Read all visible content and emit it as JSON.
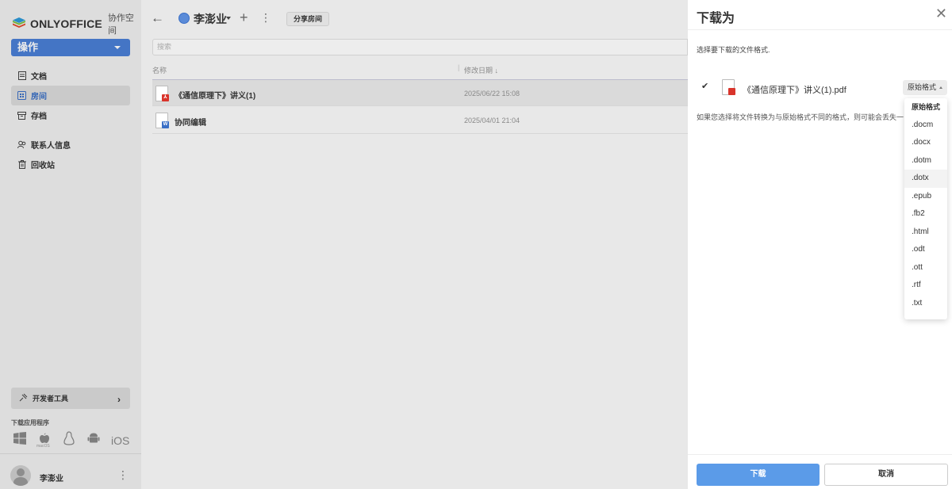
{
  "app": {
    "logo_text": "ONLYOFFICE",
    "logo_sub": "协作空间"
  },
  "sidebar": {
    "action_label": "操作",
    "items": [
      {
        "label": "文档",
        "icon": "document-icon"
      },
      {
        "label": "房间",
        "icon": "rooms-icon"
      },
      {
        "label": "存档",
        "icon": "archive-icon"
      },
      {
        "label": "联系人信息",
        "icon": "contacts-icon"
      },
      {
        "label": "回收站",
        "icon": "trash-icon"
      }
    ],
    "dev_tools_label": "开发者工具",
    "download_apps_label": "下载应用程序",
    "os_icons": [
      "windows-icon",
      "macos-icon",
      "linux-icon",
      "android-icon",
      "ios-icon"
    ],
    "ios_label": "iOS",
    "macos_label": "macOS",
    "user_name": "李澎业"
  },
  "main": {
    "room_title": "李澎业",
    "share_button": "分享房间",
    "search_placeholder": "搜索",
    "columns": {
      "name": "名称",
      "date": "修改日期"
    },
    "rows": [
      {
        "name": "《通信原理下》讲义(1)",
        "date": "2025/06/22 15:08",
        "type": "pdf"
      },
      {
        "name": "协同编辑",
        "date": "2025/04/01 21:04",
        "type": "docx"
      }
    ]
  },
  "panel": {
    "title": "下载为",
    "hint": "选择要下载的文件格式.",
    "file_name": "《通信原理下》讲义(1).pdf",
    "selected_format": "原始格式",
    "warning": "如果您选择将文件转换为与原始格式不同的格式，则可能会丢失一",
    "format_options": [
      "原始格式",
      ".docm",
      ".docx",
      ".dotm",
      ".dotx",
      ".epub",
      ".fb2",
      ".html",
      ".odt",
      ".ott",
      ".rtf",
      ".txt"
    ],
    "download_button": "下载",
    "cancel_button": "取消"
  },
  "colors": {
    "accent": "#4a7fd6",
    "download_button": "#5b9be8",
    "pdf_badge": "#d9342b",
    "docx_badge": "#3a6fc6"
  }
}
